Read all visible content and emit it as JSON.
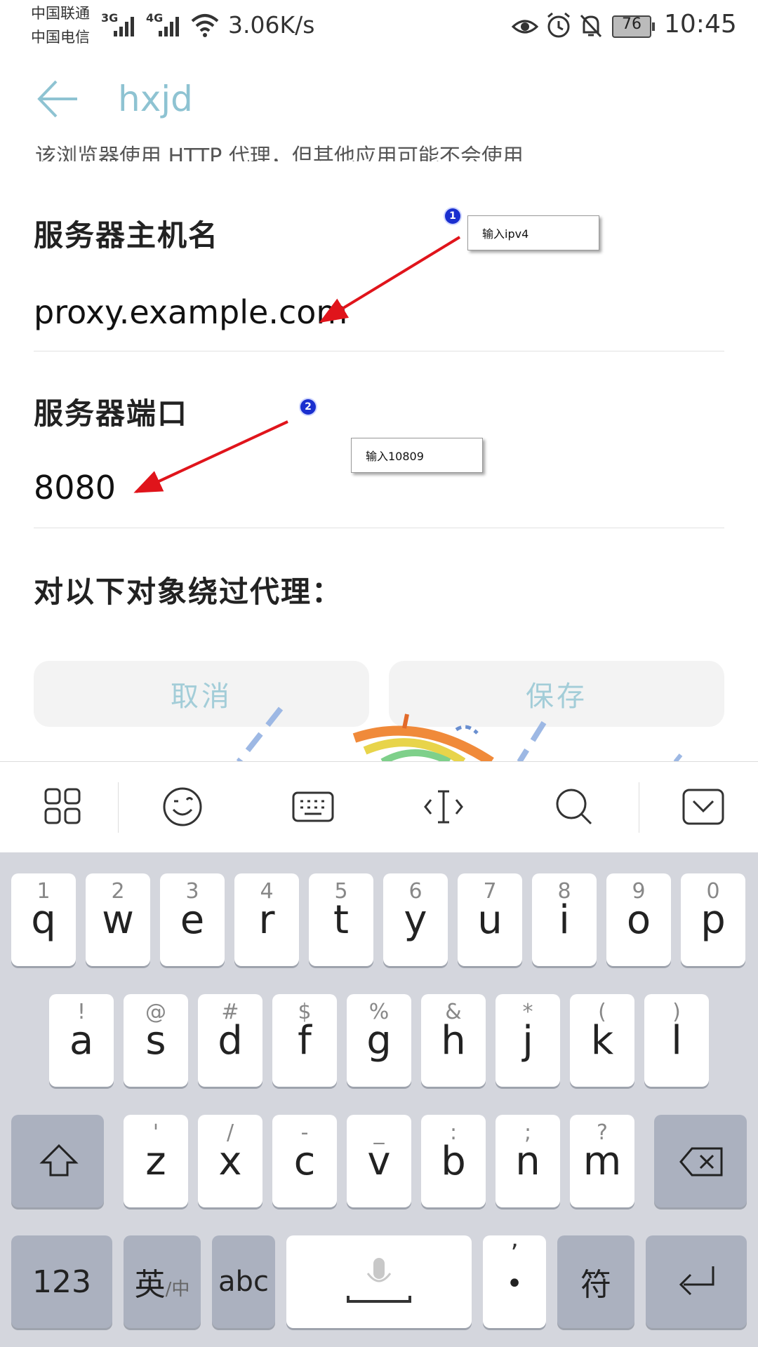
{
  "status_bar": {
    "carrier1": "中国联通",
    "carrier2": "中国电信",
    "net1": "3G",
    "net2": "4G",
    "speed": "3.06K/s",
    "battery": "76",
    "time": "10:45",
    "icons": [
      "signal-icon",
      "wifi-icon",
      "eye-icon",
      "alarm-icon",
      "mute-icon",
      "battery-icon"
    ]
  },
  "header": {
    "title": "hxjd",
    "back_icon": "back-arrow-icon"
  },
  "form": {
    "cut_text": "该浏览器使用 HTTP 代理，但其他应用可能不会使用",
    "host_label": "服务器主机名",
    "host_value": "proxy.example.com",
    "port_label": "服务器端口",
    "port_value": "8080",
    "bypass_label": "对以下对象绕过代理："
  },
  "buttons": {
    "cancel": "取消",
    "save": "保存"
  },
  "annotations": [
    {
      "number": "1",
      "text": "输入ipv4"
    },
    {
      "number": "2",
      "text": "输入10809"
    }
  ],
  "annotation_color": "#e0141b",
  "toolbar_icons": [
    "apps-grid-icon",
    "emoji-icon",
    "keyboard-icon",
    "cursor-icon",
    "search-icon",
    "hide-keyboard-icon"
  ],
  "keyboard": {
    "row1": [
      {
        "sub": "1",
        "key": "q"
      },
      {
        "sub": "2",
        "key": "w"
      },
      {
        "sub": "3",
        "key": "e"
      },
      {
        "sub": "4",
        "key": "r"
      },
      {
        "sub": "5",
        "key": "t"
      },
      {
        "sub": "6",
        "key": "y"
      },
      {
        "sub": "7",
        "key": "u"
      },
      {
        "sub": "8",
        "key": "i"
      },
      {
        "sub": "9",
        "key": "o"
      },
      {
        "sub": "0",
        "key": "p"
      }
    ],
    "row2": [
      {
        "sub": "!",
        "key": "a"
      },
      {
        "sub": "@",
        "key": "s"
      },
      {
        "sub": "#",
        "key": "d"
      },
      {
        "sub": "$",
        "key": "f"
      },
      {
        "sub": "%",
        "key": "g"
      },
      {
        "sub": "&",
        "key": "h"
      },
      {
        "sub": "*",
        "key": "j"
      },
      {
        "sub": "(",
        "key": "k"
      },
      {
        "sub": ")",
        "key": "l"
      }
    ],
    "row3": [
      {
        "sub": "'",
        "key": "z"
      },
      {
        "sub": "/",
        "key": "x"
      },
      {
        "sub": "-",
        "key": "c"
      },
      {
        "sub": "_",
        "key": "v"
      },
      {
        "sub": ":",
        "key": "b"
      },
      {
        "sub": ";",
        "key": "n"
      },
      {
        "sub": "?",
        "key": "m"
      }
    ],
    "shift_icon": "shift-icon",
    "backspace_icon": "backspace-icon",
    "num_label": "123",
    "lang_main": "英",
    "lang_sub": "/中",
    "abc_label": "abc",
    "mic_icon": "microphone-icon",
    "comma_top": "’",
    "period": "•",
    "symbols_label": "符",
    "enter_icon": "enter-icon"
  }
}
